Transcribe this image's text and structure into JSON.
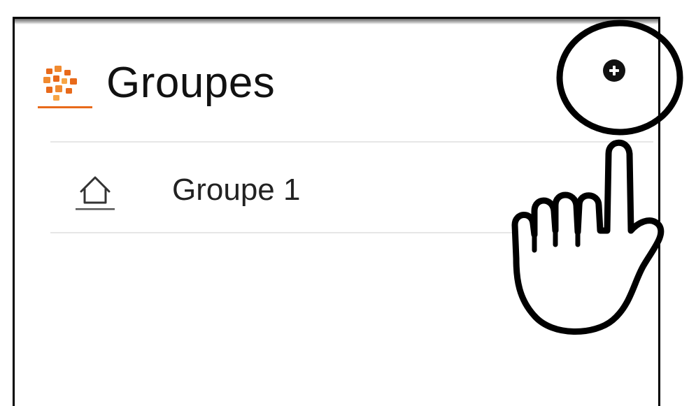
{
  "header": {
    "title": "Groupes",
    "logo_icon": "groups-logo-icon",
    "add_button_icon": "plus-circle-icon"
  },
  "groups": [
    {
      "label": "Groupe 1",
      "icon": "home-icon"
    }
  ],
  "colors": {
    "accent": "#e86a1b",
    "text": "#111111",
    "divider": "#e6e6e6"
  }
}
